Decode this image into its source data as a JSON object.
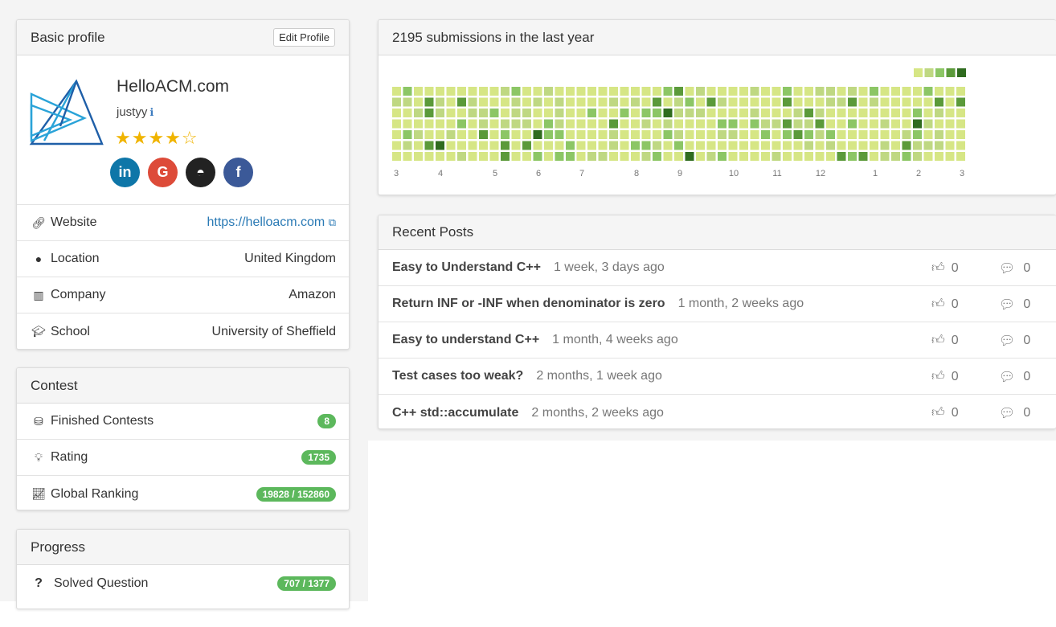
{
  "basic_profile": {
    "heading": "Basic profile",
    "edit_label": "Edit Profile",
    "realname": "HelloACM.com",
    "username": "justyy",
    "info_glyph": "ℹ",
    "stars_filled": "★★★★",
    "stars_empty": "☆",
    "rating_stars": 4,
    "socials": [
      {
        "name": "linkedin-icon",
        "glyph": "in",
        "color": "#0e76a8"
      },
      {
        "name": "google-icon",
        "glyph": "G",
        "color": "#dd4b39"
      },
      {
        "name": "github-icon",
        "glyph": "◓",
        "color": "#222222"
      },
      {
        "name": "facebook-icon",
        "glyph": "f",
        "color": "#3b5998"
      }
    ],
    "rows": [
      {
        "icon": "link-icon",
        "label": "Website",
        "value": "https://helloacm.com"
      },
      {
        "icon": "globe-icon",
        "label": "Location",
        "value": "United Kingdom"
      },
      {
        "icon": "building-icon",
        "label": "Company",
        "value": "Amazon"
      },
      {
        "icon": "graduation-cap-icon",
        "label": "School",
        "value": "University of Sheffield"
      }
    ]
  },
  "contest": {
    "heading": "Contest",
    "rows": [
      {
        "icon": "cubes-icon",
        "label": "Finished Contests",
        "badge": "8"
      },
      {
        "icon": "lightbulb-icon",
        "label": "Rating",
        "badge": "1735"
      },
      {
        "icon": "line-chart-icon",
        "label": "Global Ranking",
        "badge": "19828 / 152860"
      }
    ]
  },
  "progress": {
    "heading": "Progress",
    "rows": [
      {
        "icon": "question-icon",
        "label": "Solved Question",
        "badge": "707 / 1377"
      }
    ]
  },
  "submissions": {
    "heading": "2195 submissions in the last year",
    "month_labels": [
      "3",
      "4",
      "5",
      "6",
      "7",
      "8",
      "9",
      "10",
      "11",
      "12",
      "1",
      "2",
      "3"
    ],
    "colors": [
      "#d6e685",
      "#bfd882",
      "#8cc665",
      "#5b9a3a",
      "#2f6b1f"
    ],
    "weeks": 53
  },
  "recent_posts": {
    "heading": "Recent Posts",
    "posts": [
      {
        "title": "Easy to Understand C++",
        "time": "1 week, 3 days ago",
        "likes": "0",
        "comments": "0"
      },
      {
        "title": "Return INF or -INF when denominator is zero",
        "time": "1 month, 2 weeks ago",
        "likes": "0",
        "comments": "0"
      },
      {
        "title": "Easy to understand C++",
        "time": "1 month, 4 weeks ago",
        "likes": "0",
        "comments": "0"
      },
      {
        "title": "Test cases too weak?",
        "time": "2 months, 1 week ago",
        "likes": "0",
        "comments": "0"
      },
      {
        "title": "C++ std::accumulate",
        "time": "2 months, 2 weeks ago",
        "likes": "0",
        "comments": "0"
      }
    ]
  }
}
